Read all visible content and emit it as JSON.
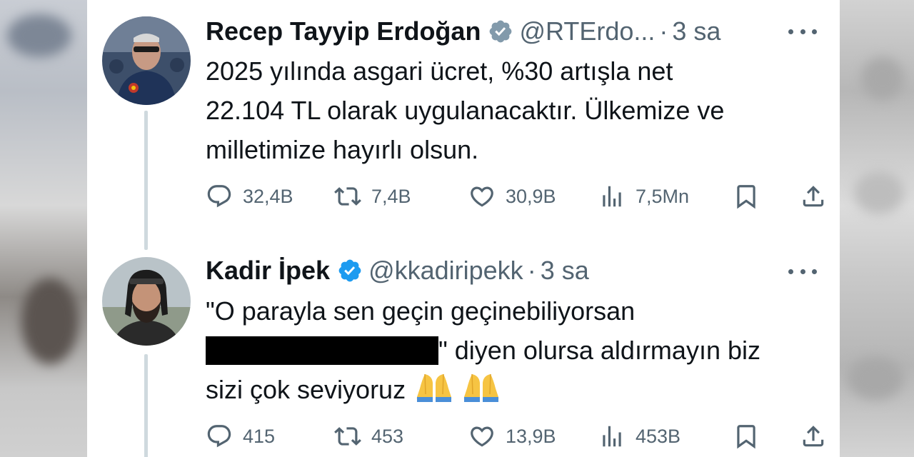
{
  "tweets": [
    {
      "name": "Recep Tayyip Erdoğan",
      "handle": "@RTErdo...",
      "dot": "·",
      "time": "3 sa",
      "lines": [
        "2025 yılında asgari ücret, %30 artışla net",
        "22.104 TL olarak uygulanacaktır. Ülkemize ve",
        "milletimize hayırlı olsun."
      ],
      "stats": {
        "replies": "32,4B",
        "reposts": "7,4B",
        "likes": "30,9B",
        "views": "7,5Mn"
      }
    },
    {
      "name": "Kadir İpek",
      "handle": "@kkadiripekk",
      "dot": "·",
      "time": "3 sa",
      "line1": "\"O parayla sen geçin geçinebiliyorsan",
      "line2_after_redaction": "\" diyen olursa aldırmayın biz",
      "line3": "sizi çok seviyoruz",
      "stats": {
        "replies": "415",
        "reposts": "453",
        "likes": "13,9B",
        "views": "453B"
      }
    }
  ],
  "icons": {
    "verified": "verified-badge-icon",
    "more": "more-icon",
    "reply": "reply-icon",
    "repost": "repost-icon",
    "like": "like-icon",
    "views": "views-icon",
    "bookmark": "bookmark-icon",
    "share": "share-icon",
    "emoji": "folded-hands-emoji"
  },
  "colors": {
    "text": "#0f1419",
    "secondary": "#536471",
    "verified": "#1d9bf0",
    "thread_line": "#cfd9de",
    "redaction": "#000000"
  }
}
